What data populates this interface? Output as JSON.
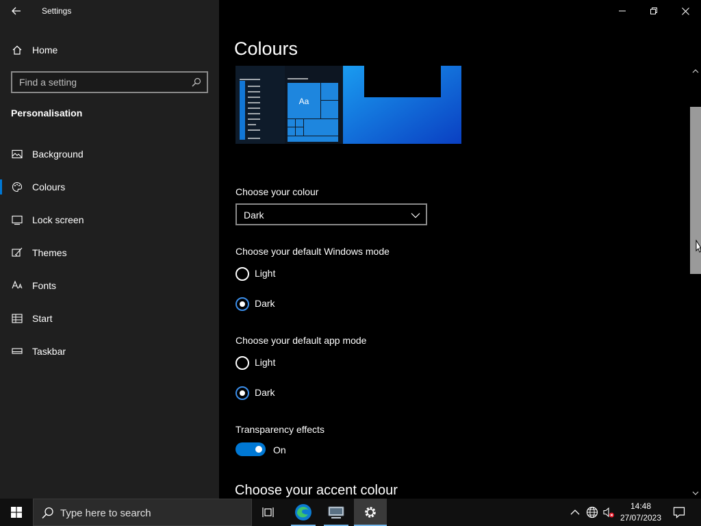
{
  "window": {
    "app_title": "Settings"
  },
  "sidebar": {
    "home_label": "Home",
    "search_placeholder": "Find a setting",
    "section_heading": "Personalisation",
    "items": [
      {
        "label": "Background",
        "icon": "picture-icon"
      },
      {
        "label": "Colours",
        "icon": "palette-icon",
        "active": true
      },
      {
        "label": "Lock screen",
        "icon": "lock-screen-icon"
      },
      {
        "label": "Themes",
        "icon": "brush-icon"
      },
      {
        "label": "Fonts",
        "icon": "font-icon"
      },
      {
        "label": "Start",
        "icon": "start-icon"
      },
      {
        "label": "Taskbar",
        "icon": "taskbar-icon"
      }
    ]
  },
  "main": {
    "title": "Colours",
    "preview": {
      "tile_text": "Aa"
    },
    "choose_colour": {
      "label": "Choose your colour",
      "selected": "Dark"
    },
    "windows_mode": {
      "label": "Choose your default Windows mode",
      "options": [
        "Light",
        "Dark"
      ],
      "selected": "Dark"
    },
    "app_mode": {
      "label": "Choose your default app mode",
      "options": [
        "Light",
        "Dark"
      ],
      "selected": "Dark"
    },
    "transparency": {
      "label": "Transparency effects",
      "state": "On"
    },
    "accent_heading": "Choose your accent colour"
  },
  "taskbar": {
    "search_placeholder": "Type here to search",
    "time": "14:48",
    "date": "27/07/2023"
  },
  "colors": {
    "accent": "#0078d4",
    "sidebar_bg": "#1f1f1f",
    "content_bg": "#000000",
    "taskbar_bg": "#101010"
  }
}
